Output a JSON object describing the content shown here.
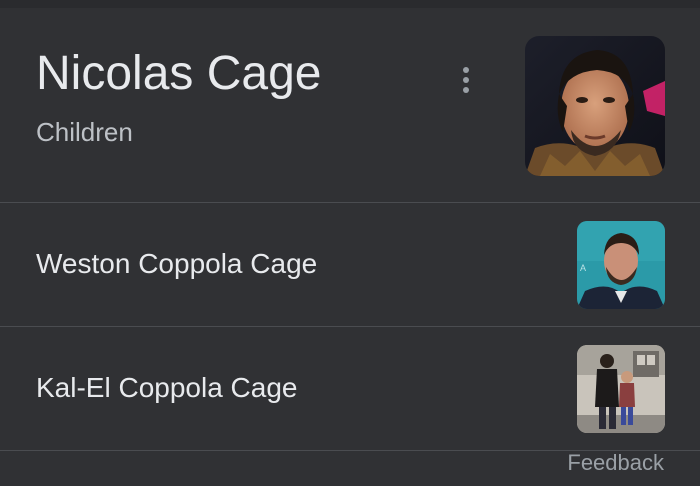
{
  "header": {
    "title": "Nicolas Cage",
    "subtitle": "Children",
    "menu_icon": "more-vert-icon",
    "photo_description": "portrait-photo"
  },
  "children": [
    {
      "name": "Weston Coppola Cage",
      "thumbnail": "portrait-photo"
    },
    {
      "name": "Kal-El Coppola Cage",
      "thumbnail": "street-photo"
    }
  ],
  "footer": {
    "feedback_label": "Feedback"
  },
  "colors": {
    "background": "#303134",
    "primary_text": "#e8eaed",
    "secondary_text": "#bdc1c6",
    "muted_text": "#9aa0a6",
    "divider": "#4a4c50"
  }
}
